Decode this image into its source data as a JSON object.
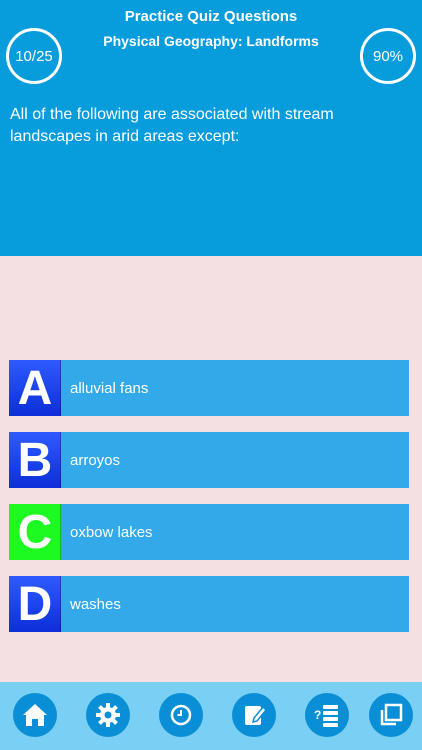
{
  "header": {
    "title": "Practice Quiz Questions",
    "subtitle": "Physical Geography: Landforms",
    "progress": "10/25",
    "score": "90%"
  },
  "question": {
    "text": "All of the following are associated with stream landscapes in arid areas except:"
  },
  "options": [
    {
      "letter": "A",
      "text": "alluvial fans",
      "state": "normal"
    },
    {
      "letter": "B",
      "text": "arroyos",
      "state": "normal"
    },
    {
      "letter": "C",
      "text": "oxbow lakes",
      "state": "correct"
    },
    {
      "letter": "D",
      "text": "washes",
      "state": "normal"
    }
  ],
  "toolbar": {
    "icons": [
      "home-icon",
      "gear-icon",
      "clock-icon",
      "edit-note-icon",
      "question-list-icon",
      "copy-icon"
    ]
  },
  "colors": {
    "header_bg": "#079ddd",
    "body_bg": "#f4dfe2",
    "option_bg": "#33a9ea",
    "letter_bg": "#0b2fd8",
    "correct_letter_bg": "#1dfa22",
    "toolbar_bg": "#79cff4",
    "toolbar_button": "#0a8fd6"
  }
}
